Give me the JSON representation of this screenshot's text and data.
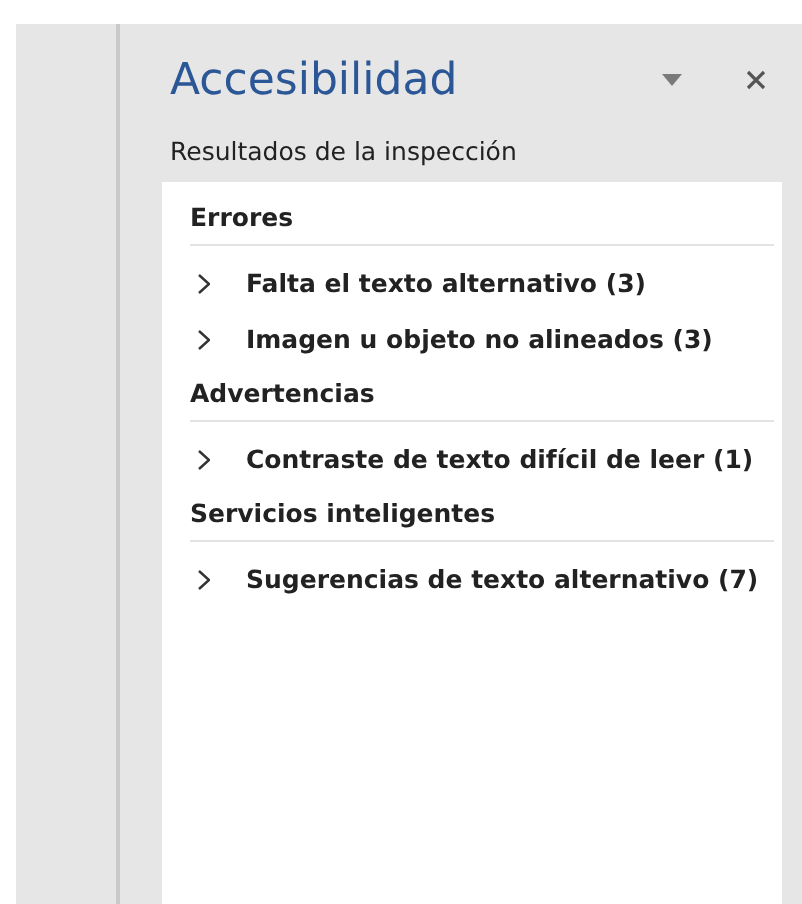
{
  "pane": {
    "title": "Accesibilidad",
    "subtitle": "Resultados de la inspección"
  },
  "groups": [
    {
      "heading": "Errores",
      "items": [
        {
          "label": "Falta el texto alternativo (3)",
          "expanded": false
        },
        {
          "label": "Imagen u objeto no alineados (3)",
          "expanded": false
        }
      ]
    },
    {
      "heading": "Advertencias",
      "items": [
        {
          "label": "Contraste de texto difícil de leer (1)",
          "expanded": false
        }
      ]
    },
    {
      "heading": "Servicios inteligentes",
      "items": [
        {
          "label": "Sugerencias de texto alternativo (7)",
          "expanded": false
        }
      ]
    }
  ]
}
